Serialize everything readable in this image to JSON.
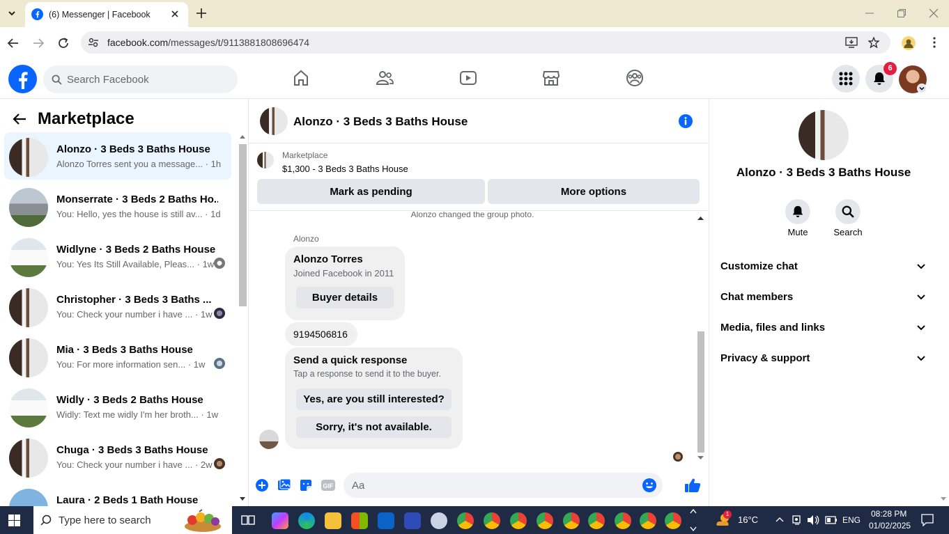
{
  "browser": {
    "tab_title": "(6) Messenger | Facebook",
    "url_host": "facebook.com",
    "url_path": "/messages/t/9113881808696474"
  },
  "fb": {
    "search_placeholder": "Search Facebook",
    "notification_count": "6",
    "brand_color": "#0866ff"
  },
  "left": {
    "title": "Marketplace",
    "conversations": [
      {
        "name": "Alonzo · 3 Beds 3 Baths House",
        "preview": "Alonzo Torres sent you a message... · 1h"
      },
      {
        "name": "Monserrate · 3 Beds 2 Baths Ho...",
        "preview": "You: Hello, yes the house is still av... · 1d"
      },
      {
        "name": "Widlyne · 3 Beds 2 Baths House",
        "preview": "You: Yes Its Still Available, Pleas... · 1w"
      },
      {
        "name": "Christopher · 3 Beds 3 Baths ...",
        "preview": "You: Check your number i have ... · 1w"
      },
      {
        "name": "Mia · 3 Beds 3 Baths House",
        "preview": "You: For more information sen... · 1w"
      },
      {
        "name": "Widly · 3 Beds 2 Baths House",
        "preview": "Widly: Text me widly I'm her broth... · 1w"
      },
      {
        "name": "Chuga · 3 Beds 3 Baths House",
        "preview": "You: Check your number i have ... · 2w"
      },
      {
        "name": "Laura · 2 Beds 1 Bath House",
        "preview": ""
      }
    ]
  },
  "chat": {
    "title": "Alonzo · 3 Beds 3 Baths House",
    "listing_label": "Marketplace",
    "listing_price": "$1,300 - 3 Beds 3 Baths House",
    "mark_pending": "Mark as pending",
    "more_options": "More options",
    "system_message": "Alonzo changed the group photo.",
    "sender": "Alonzo",
    "buyer_card": {
      "name": "Alonzo Torres",
      "joined": "Joined Facebook in 2011",
      "button": "Buyer details"
    },
    "phone_message": "9194506816",
    "quick": {
      "title": "Send a quick response",
      "subtitle": "Tap a response to send it to the buyer.",
      "option1": "Yes, are you still interested?",
      "option2": "Sorry, it's not available."
    },
    "input_placeholder": "Aa"
  },
  "right": {
    "name": "Alonzo · 3 Beds 3 Baths House",
    "mute": "Mute",
    "search": "Search",
    "sections": [
      "Customize chat",
      "Chat members",
      "Media, files and links",
      "Privacy & support"
    ]
  },
  "taskbar": {
    "search_placeholder": "Type here to search",
    "weather": "16°C",
    "weather_badge": "1",
    "lang": "ENG",
    "time": "08:28 PM",
    "date": "01/02/2025"
  }
}
